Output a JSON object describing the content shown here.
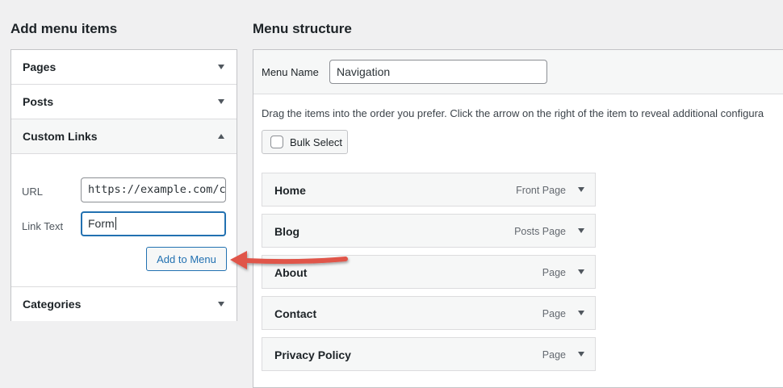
{
  "left_panel": {
    "title": "Add menu items",
    "sections": {
      "pages": "Pages",
      "posts": "Posts",
      "custom_links": "Custom Links",
      "categories": "Categories"
    },
    "custom_links": {
      "url_label": "URL",
      "url_value": "https://example.com/c",
      "link_text_label": "Link Text",
      "link_text_value": "Form",
      "add_button": "Add to Menu"
    }
  },
  "right_panel": {
    "title": "Menu structure",
    "menu_name_label": "Menu Name",
    "menu_name_value": "Navigation",
    "instructions": "Drag the items into the order you prefer. Click the arrow on the right of the item to reveal additional configura",
    "bulk_select": "Bulk Select",
    "items": [
      {
        "title": "Home",
        "type": "Front Page"
      },
      {
        "title": "Blog",
        "type": "Posts Page"
      },
      {
        "title": "About",
        "type": "Page"
      },
      {
        "title": "Contact",
        "type": "Page"
      },
      {
        "title": "Privacy Policy",
        "type": "Page"
      }
    ]
  },
  "colors": {
    "accent": "#2271b1",
    "arrow": "#e0554a",
    "background": "#f0f0f1"
  },
  "icons": [
    "chevron-down-icon",
    "chevron-up-icon",
    "checkbox-icon",
    "annotation-arrow-icon"
  ]
}
